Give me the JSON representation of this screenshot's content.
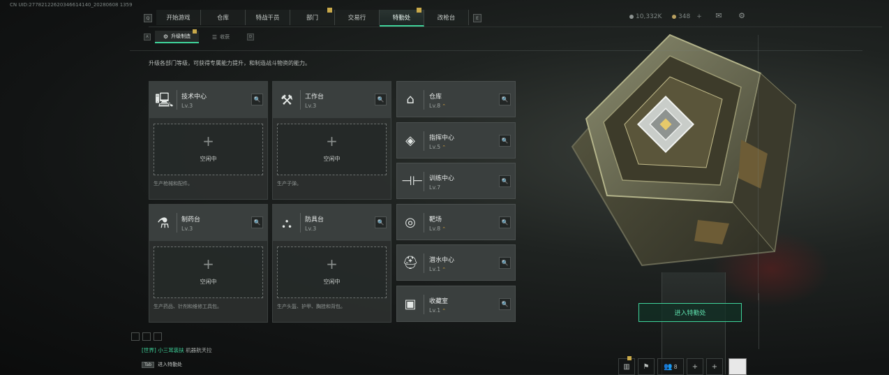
{
  "uid": "CN UID:27782122620346614140_20280608 1359",
  "nav": {
    "key_left": "Q",
    "key_right": "E",
    "tabs": [
      {
        "label": "开始游戏",
        "badge": false,
        "active": false
      },
      {
        "label": "仓库",
        "badge": false,
        "active": false
      },
      {
        "label": "特战干员",
        "badge": false,
        "active": false
      },
      {
        "label": "部门",
        "badge": true,
        "active": false
      },
      {
        "label": "交易行",
        "badge": false,
        "active": false
      },
      {
        "label": "特勤处",
        "badge": true,
        "active": true
      },
      {
        "label": "改枪台",
        "badge": false,
        "active": false
      }
    ]
  },
  "currency": {
    "coins": "10,332K",
    "tickets": "348",
    "plus": "+"
  },
  "subnav": {
    "key_left": "A",
    "key_right": "D",
    "tabs": [
      {
        "label": "升级制造",
        "active": true,
        "badge": true
      },
      {
        "label": "收获",
        "active": false,
        "badge": false
      }
    ]
  },
  "description": "升级各部门等级，可获得专属能力提升，和制造战斗物资的能力。",
  "stations": [
    {
      "name": "技术中心",
      "level": "Lv.3",
      "icon": "computer-icon",
      "slot_status": "空闲中",
      "produces": "生产枪械和配件。"
    },
    {
      "name": "工作台",
      "level": "Lv.3",
      "icon": "tools-icon",
      "slot_status": "空闲中",
      "produces": "生产子弹。"
    },
    {
      "name": "制药台",
      "level": "Lv.3",
      "icon": "microscope-icon",
      "slot_status": "空闲中",
      "produces": "生产药品、针剂和维修工具包。"
    },
    {
      "name": "防具台",
      "level": "Lv.3",
      "icon": "armor-icon",
      "slot_status": "空闲中",
      "produces": "生产头盔、护甲、胸挂和背包。"
    }
  ],
  "facilities": [
    {
      "name": "仓库",
      "level": "Lv.8",
      "icon": "warehouse-icon",
      "upgradable": true
    },
    {
      "name": "指挥中心",
      "level": "Lv.5",
      "icon": "command-icon",
      "upgradable": true
    },
    {
      "name": "训练中心",
      "level": "Lv.7",
      "icon": "dumbbell-icon",
      "upgradable": false
    },
    {
      "name": "靶场",
      "level": "Lv.8",
      "icon": "target-icon",
      "upgradable": true
    },
    {
      "name": "潜水中心",
      "level": "Lv.1",
      "icon": "dive-icon",
      "upgradable": true
    },
    {
      "name": "收藏室",
      "level": "Lv.1",
      "icon": "collection-icon",
      "upgradable": true
    }
  ],
  "enter_button": "进入特勤处",
  "chat": {
    "channel": "[世界]",
    "user": "小三耳装扶",
    "message": "机器航天拉"
  },
  "tab_hint": {
    "key": "Tab",
    "label": "进入特勤处"
  },
  "bottom_right": {
    "friends_count": "8"
  },
  "colors": {
    "accent": "#3fd49b",
    "badge": "#c9a94a",
    "upgrade": "#d9a640"
  }
}
